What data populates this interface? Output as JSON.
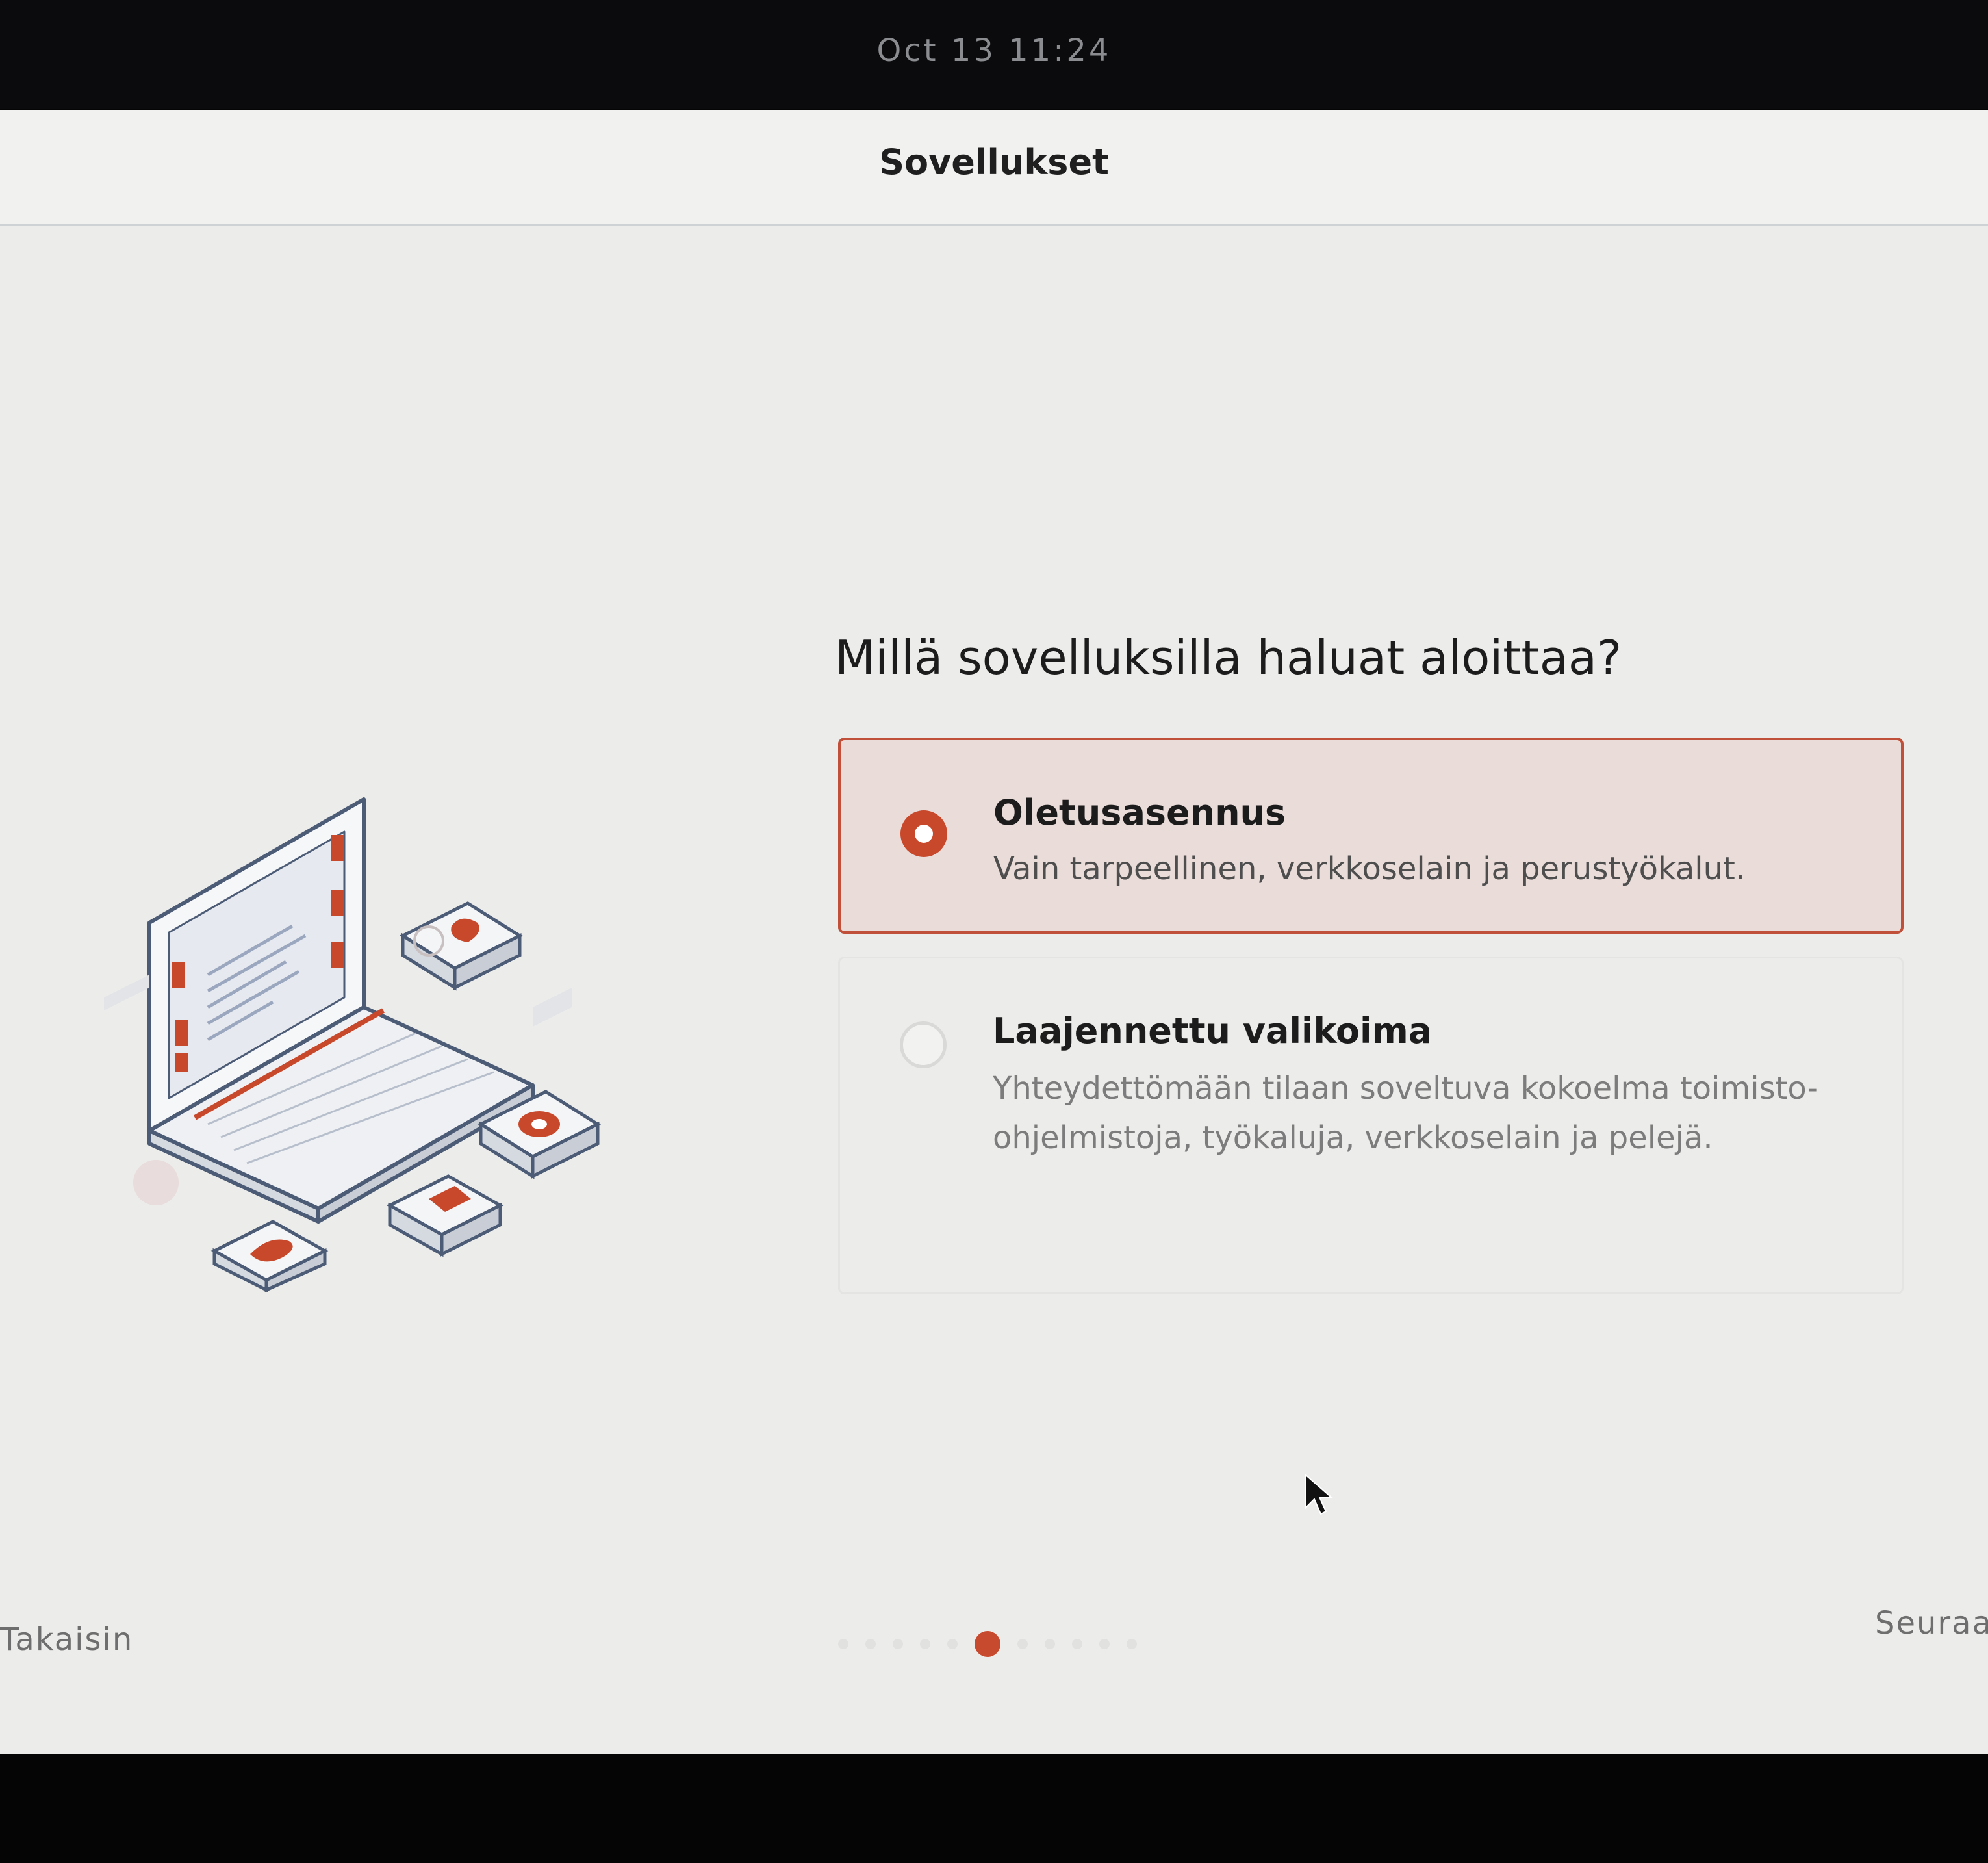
{
  "topbar": {
    "clock": "Oct 13  11:24"
  },
  "header": {
    "title": "Sovellukset"
  },
  "main": {
    "question": "Millä sovelluksilla haluat aloittaa?",
    "options": [
      {
        "title": "Oletusasennus",
        "description": "Vain tarpeellinen, verkkoselain ja perustyökalut.",
        "selected": true
      },
      {
        "title": "Laajennettu valikoima",
        "description": "Yhteydettömään tilaan soveltuva kokoelma toimisto-ohjelmistoja, työkaluja, verkkoselain ja pelejä.",
        "selected": false
      }
    ]
  },
  "footer": {
    "back_label": "Takaisin",
    "next_label": "Seuraava",
    "pager": {
      "current": 6,
      "total": 11
    }
  },
  "colors": {
    "accent": "#c8482b",
    "selected_bg": "#eadcd9",
    "window_bg": "#ececea"
  },
  "icons": [
    "laptop-illustration",
    "map-pin-icon",
    "camera-icon",
    "music-icon",
    "gamepad-icon",
    "mouse-pointer-icon"
  ]
}
